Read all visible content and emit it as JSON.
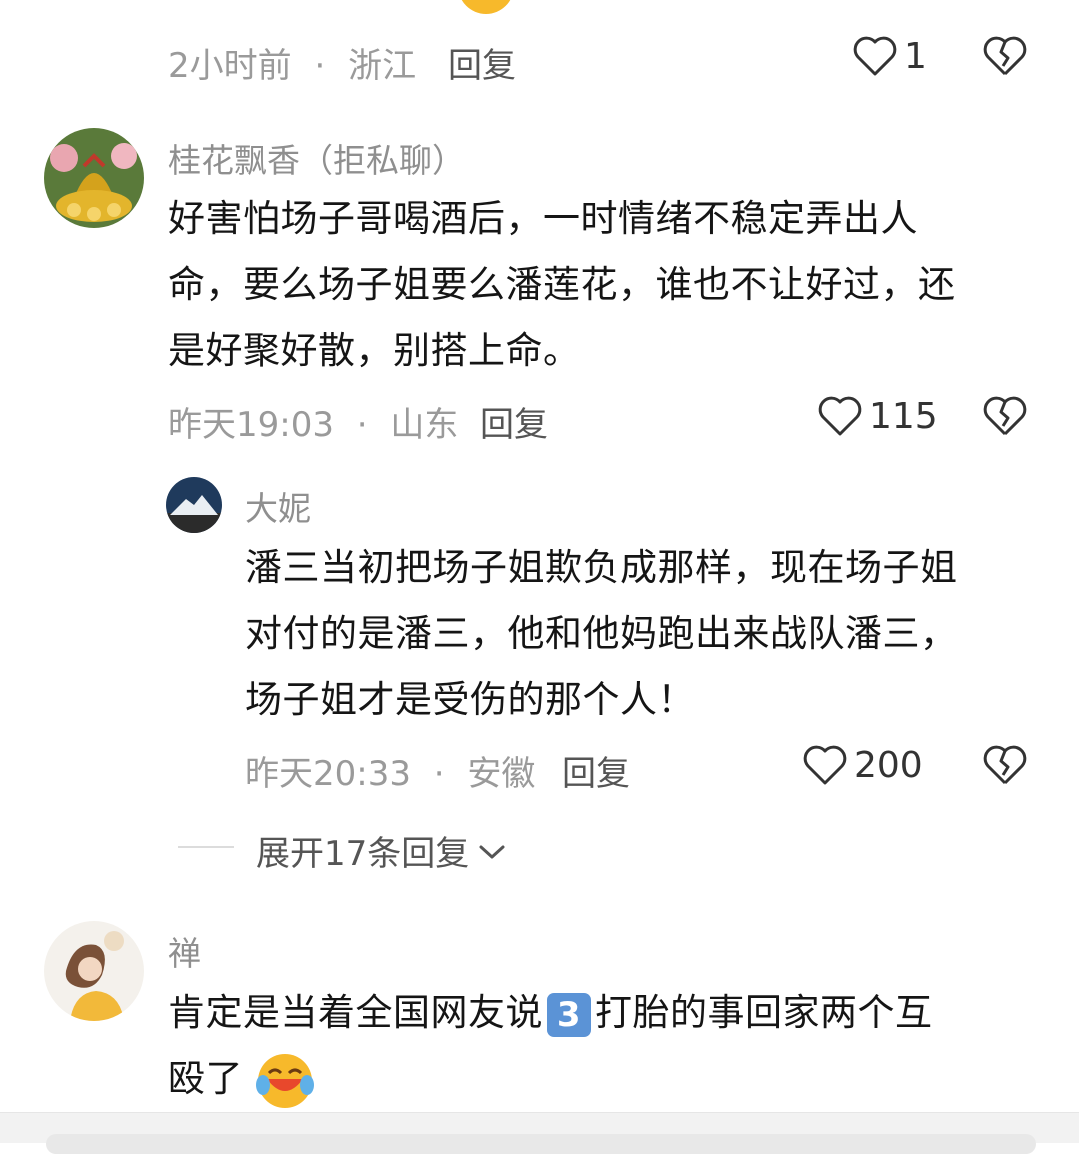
{
  "top_comment": {
    "time": "2小时前",
    "separator": "·",
    "location": "浙江",
    "reply_label": "回复",
    "likes": "1"
  },
  "comment1": {
    "username": "桂花飘香（拒私聊）",
    "text_lines": [
      "好害怕场子哥喝酒后，一时情绪不稳定弄出人",
      "命，要么场子姐要么潘莲花，谁也不让好过，还",
      "是好聚好散，别搭上命。"
    ],
    "time": "昨天19:03",
    "separator": "·",
    "location": "山东",
    "reply_label": "回复",
    "likes": "115"
  },
  "reply1": {
    "username": "大妮",
    "text_lines": [
      "潘三当初把场子姐欺负成那样，现在场子姐",
      "对付的是潘三，他和他妈跑出来战队潘三，",
      "场子姐才是受伤的那个人！"
    ],
    "time": "昨天20:33",
    "separator": "·",
    "location": "安徽",
    "reply_label": "回复",
    "likes": "200"
  },
  "expand": {
    "label": "展开17条回复"
  },
  "comment2": {
    "username": "禅",
    "text_line1_before": "肯定是当着全国网友说",
    "keycap": "3",
    "text_line1_after": "打胎的事回家两个互",
    "text_line2": "殴了"
  },
  "icons": {
    "like": "heart-outline-icon",
    "dislike": "broken-heart-icon",
    "expand": "chevron-down-icon",
    "emoji": "laughing-crying-emoji"
  }
}
